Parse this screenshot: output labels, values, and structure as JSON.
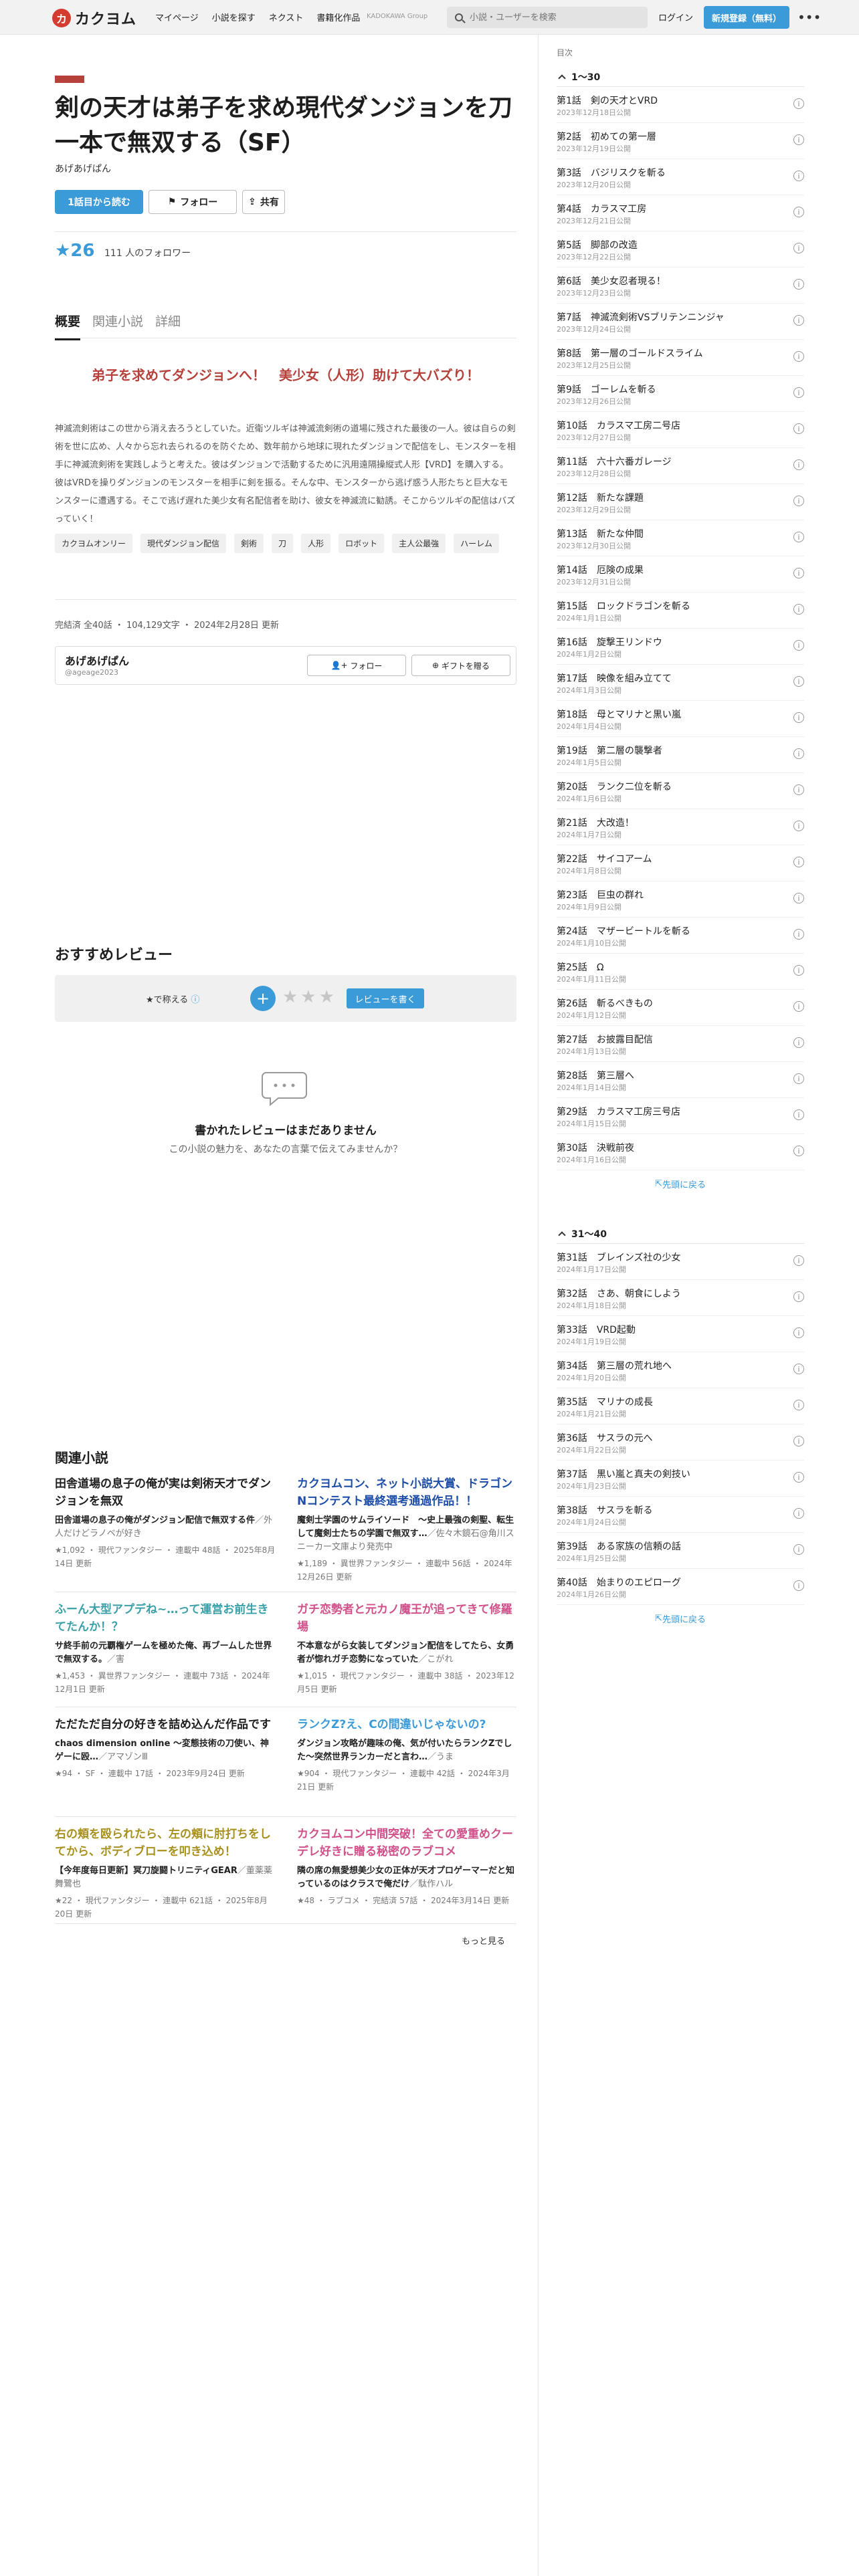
{
  "header": {
    "logo": "カクヨム",
    "nav": [
      "マイページ",
      "小説を探す",
      "ネクスト",
      "書籍化作品"
    ],
    "kadokawa": "KADOKAWA Group",
    "search_placeholder": "小説・ユーザーを検索",
    "login": "ログイン",
    "signup": "新規登録（無料）",
    "more": "•••"
  },
  "work": {
    "title": "剣の天才は弟子を求め現代ダンジョンを刀一本で無双する（SF）",
    "author": "あげあげぱん",
    "read_btn": "1話目から読む",
    "follow_btn": "フォロー",
    "share_btn": "共有",
    "stars": "★26",
    "followers": "111 人のフォロワー",
    "tabs": [
      "概要",
      "関連小説",
      "詳細"
    ],
    "catch": "弟子を求めてダンジョンへ！　美少女（人形）助けて大バズり！",
    "intro": "神滅流剣術はこの世から消え去ろうとしていた。近衛ツルギは神滅流剣術の道場に残された最後の一人。彼は自らの剣術を世に広め、人々から忘れ去られるのを防ぐため、数年前から地球に現れたダンジョンで配信をし、モンスターを相手に神滅流剣術を実践しようと考えた。彼はダンジョンで活動するために汎用遠隔操縦式人形【VRD】を購入する。彼はVRDを操りダンジョンのモンスターを相手に剣を振る。そんな中、モンスターから逃げ惑う人形たちと巨大なモンスターに遭遇する。そこで逃げ遅れた美少女有名配信者を助け、彼女を神滅流に勧誘。そこからツルギの配信はバズっていく！",
    "tags": [
      "カクヨムオンリー",
      "現代ダンジョン配信",
      "剣術",
      "刀",
      "人形",
      "ロボット",
      "主人公最強",
      "ハーレム"
    ],
    "meta": "完結済 全40話 ・ 104,129文字 ・ 2024年2月28日 更新",
    "author_box": {
      "name": "あげあげぱん",
      "id": "@ageage2023",
      "follow": "フォロー",
      "gift": "ギフトを贈る"
    }
  },
  "reviews": {
    "title": "おすすめレビュー",
    "label": "★で称える",
    "stars": "★★★",
    "write_btn": "レビューを書く",
    "empty_title": "書かれたレビューはまだありません",
    "empty_sub": "この小説の魅力を、あなたの言葉で伝えてみませんか？"
  },
  "related": {
    "title": "関連小説",
    "more": "もっと見る",
    "items": [
      {
        "title": "田舎道場の息子の俺が実は剣術天才でダンジョンを無双",
        "sub": "田舎道場の息子の俺がダンジョン配信で無双する件",
        "author": "／外人だけどラノベが好き",
        "meta": "★1,092 ・ 現代ファンタジー ・ 連載中 48話 ・ 2025年8月14日 更新",
        "color": "#1e1e1e"
      },
      {
        "title": "カクヨムコン、ネット小説大賞、ドラゴンNコンテスト最終選考通過作品！！",
        "sub": "魔剣士学園のサムライソード　～史上最強の剣聖、転生して魔剣士たちの学園で無双す…",
        "author": "／佐々木鏡石@角川スニーカー文庫より発売中",
        "meta": "★1,189 ・ 異世界ファンタジー ・ 連載中 56話 ・ 2024年12月26日 更新",
        "color": "#1e4ea8"
      },
      {
        "title": "ふーん大型アプデね~…って運営お前生きてたんか！？",
        "sub": "サ終手前の元覇権ゲームを極めた俺、再ブームした世界で無双する。",
        "author": "／害",
        "meta": "★1,453 ・ 異世界ファンタジー ・ 連載中 73話 ・ 2024年12月1日 更新",
        "color": "#3aa0a8"
      },
      {
        "title": "ガチ恋勢者と元カノ魔王が追ってきて修羅場",
        "sub": "不本意ながら女装してダンジョン配信をしてたら、女勇者が惚れガチ恋勢になっていた",
        "author": "／こがれ",
        "meta": "★1,015 ・ 現代ファンタジー ・ 連載中 38話 ・ 2023年12月5日 更新",
        "color": "#d0508a"
      },
      {
        "title": "ただただ自分の好きを詰め込んだ作品です",
        "sub": "chaos dimension online ～変態技術の刀使い、神ゲーに殴…",
        "author": "／アマゾンⅢ",
        "meta": "★94 ・ SF ・ 連載中 17話 ・ 2023年9月24日 更新",
        "color": "#1e1e1e"
      },
      {
        "title": "ランクZ?え、Cの間違いじゃないの?",
        "sub": "ダンジョン攻略が趣味の俺、気が付いたらランクZでした～突然世界ランカーだと言わ…",
        "author": "／うま",
        "meta": "★904 ・ 現代ファンタジー ・ 連載中 42話 ・ 2024年3月21日 更新",
        "color": "#3b9bd8"
      },
      {
        "title": "右の頬を殴られたら、左の頬に肘打ちをしてから、ボディブローを叩き込め！",
        "sub": "【今年度毎日更新】冥刀旋闘トリニティGEAR",
        "author": "／董薬薬　舞鷺也",
        "meta": "★22 ・ 現代ファンタジー ・ 連載中 621話 ・ 2025年8月20日 更新",
        "color": "#a8901e"
      },
      {
        "title": "カクヨムコン中間突破！全ての愛重めクーデレ好きに贈る秘密のラブコメ",
        "sub": "隣の席の無愛想美少女の正体が天才プロゲーマーだと知っているのはクラスで俺だけ",
        "author": "／駄作ハル",
        "meta": "★48 ・ ラブコメ ・ 完結済 57話 ・ 2024年3月14日 更新",
        "color": "#d0508a"
      }
    ]
  },
  "toc": {
    "label": "目次",
    "back_top": "先頭に戻る",
    "groups": [
      {
        "title": "1〜30",
        "episodes": [
          {
            "t": "第1話　剣の天才とVRD",
            "d": "2023年12月18日公開"
          },
          {
            "t": "第2話　初めての第一層",
            "d": "2023年12月19日公開"
          },
          {
            "t": "第3話　バジリスクを斬る",
            "d": "2023年12月20日公開"
          },
          {
            "t": "第4話　カラスマ工房",
            "d": "2023年12月21日公開"
          },
          {
            "t": "第5話　脚部の改造",
            "d": "2023年12月22日公開"
          },
          {
            "t": "第6話　美少女忍者現る！",
            "d": "2023年12月23日公開"
          },
          {
            "t": "第7話　神滅流剣術VSブリテンニンジャ",
            "d": "2023年12月24日公開"
          },
          {
            "t": "第8話　第一層のゴールドスライム",
            "d": "2023年12月25日公開"
          },
          {
            "t": "第9話　ゴーレムを斬る",
            "d": "2023年12月26日公開"
          },
          {
            "t": "第10話　カラスマ工房二号店",
            "d": "2023年12月27日公開"
          },
          {
            "t": "第11話　六十六番ガレージ",
            "d": "2023年12月28日公開"
          },
          {
            "t": "第12話　新たな課題",
            "d": "2023年12月29日公開"
          },
          {
            "t": "第13話　新たな仲間",
            "d": "2023年12月30日公開"
          },
          {
            "t": "第14話　厄険の成果",
            "d": "2023年12月31日公開"
          },
          {
            "t": "第15話　ロックドラゴンを斬る",
            "d": "2024年1月1日公開"
          },
          {
            "t": "第16話　旋撃王リンドウ",
            "d": "2024年1月2日公開"
          },
          {
            "t": "第17話　映像を組み立てて",
            "d": "2024年1月3日公開"
          },
          {
            "t": "第18話　母とマリナと黒い嵐",
            "d": "2024年1月4日公開"
          },
          {
            "t": "第19話　第二層の襲撃者",
            "d": "2024年1月5日公開"
          },
          {
            "t": "第20話　ランク二位を斬る",
            "d": "2024年1月6日公開"
          },
          {
            "t": "第21話　大改造！",
            "d": "2024年1月7日公開"
          },
          {
            "t": "第22話　サイコアーム",
            "d": "2024年1月8日公開"
          },
          {
            "t": "第23話　巨虫の群れ",
            "d": "2024年1月9日公開"
          },
          {
            "t": "第24話　マザービートルを斬る",
            "d": "2024年1月10日公開"
          },
          {
            "t": "第25話　Ω",
            "d": "2024年1月11日公開"
          },
          {
            "t": "第26話　斬るべきもの",
            "d": "2024年1月12日公開"
          },
          {
            "t": "第27話　お披露目配信",
            "d": "2024年1月13日公開"
          },
          {
            "t": "第28話　第三層へ",
            "d": "2024年1月14日公開"
          },
          {
            "t": "第29話　カラスマ工房三号店",
            "d": "2024年1月15日公開"
          },
          {
            "t": "第30話　決戦前夜",
            "d": "2024年1月16日公開"
          }
        ]
      },
      {
        "title": "31〜40",
        "episodes": [
          {
            "t": "第31話　ブレインズ社の少女",
            "d": "2024年1月17日公開"
          },
          {
            "t": "第32話　さあ、朝食にしよう",
            "d": "2024年1月18日公開"
          },
          {
            "t": "第33話　VRD起動",
            "d": "2024年1月19日公開"
          },
          {
            "t": "第34話　第三層の荒れ地へ",
            "d": "2024年1月20日公開"
          },
          {
            "t": "第35話　マリナの成長",
            "d": "2024年1月21日公開"
          },
          {
            "t": "第36話　サスラの元へ",
            "d": "2024年1月22日公開"
          },
          {
            "t": "第37話　黒い嵐と真夫の剣技い",
            "d": "2024年1月23日公開"
          },
          {
            "t": "第38話　サスラを斬る",
            "d": "2024年1月24日公開"
          },
          {
            "t": "第39話　ある家族の信頼の話",
            "d": "2024年1月25日公開"
          },
          {
            "t": "第40話　始まりのエピローグ",
            "d": "2024年1月26日公開"
          }
        ]
      }
    ]
  }
}
